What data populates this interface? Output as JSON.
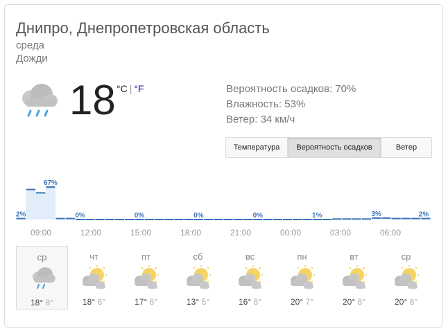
{
  "location": "Днипро, Днепропетровская область",
  "day": "среда",
  "condition": "Дожди",
  "current": {
    "temp": "18",
    "unit_c": "°C",
    "unit_sep": "|",
    "unit_f": "°F",
    "icon": "rain-cloud-icon"
  },
  "details": {
    "precip": "Вероятность осадков: 70%",
    "humidity": "Влажность: 53%",
    "wind": "Ветер: 34 км/ч"
  },
  "tabs": [
    {
      "label": "Температура",
      "active": false
    },
    {
      "label": "Вероятность осадков",
      "active": true
    },
    {
      "label": "Ветер",
      "active": false
    }
  ],
  "chart_data": {
    "type": "bar",
    "series_name": "Вероятность осадков",
    "unit": "%",
    "hourly_values": [
      2,
      62,
      55,
      67,
      2,
      2,
      0,
      0,
      0,
      0,
      0,
      0,
      0,
      0,
      0,
      0,
      0,
      0,
      0,
      0,
      0,
      0,
      0,
      0,
      0,
      0,
      0,
      0,
      0,
      0,
      0,
      0,
      1,
      1,
      1,
      1,
      3,
      3,
      2,
      2,
      2,
      2
    ],
    "labeled_points": [
      {
        "index": 0,
        "label": "2%"
      },
      {
        "index": 3,
        "label": "67%"
      },
      {
        "index": 6,
        "label": "0%"
      },
      {
        "index": 12,
        "label": "0%"
      },
      {
        "index": 18,
        "label": "0%"
      },
      {
        "index": 24,
        "label": "0%"
      },
      {
        "index": 30,
        "label": "1%"
      },
      {
        "index": 36,
        "label": "3%"
      },
      {
        "index": 41,
        "label": "2%"
      }
    ],
    "x_ticks": [
      "09:00",
      "12:00",
      "15:00",
      "18:00",
      "21:00",
      "00:00",
      "03:00",
      "06:00"
    ],
    "ylim": [
      0,
      100
    ],
    "color": "#3a72b7",
    "fill_color": "#e1edf9"
  },
  "forecast": [
    {
      "day": "ср",
      "hi": "18",
      "lo": "8",
      "icon": "rain-cloud-icon",
      "selected": true
    },
    {
      "day": "чт",
      "hi": "18",
      "lo": "6",
      "icon": "partly-cloudy-icon",
      "selected": false
    },
    {
      "day": "пт",
      "hi": "17",
      "lo": "6",
      "icon": "partly-cloudy-icon",
      "selected": false
    },
    {
      "day": "сб",
      "hi": "13",
      "lo": "5",
      "icon": "partly-cloudy-icon",
      "selected": false
    },
    {
      "day": "вс",
      "hi": "16",
      "lo": "8",
      "icon": "partly-cloudy-icon",
      "selected": false
    },
    {
      "day": "пн",
      "hi": "20",
      "lo": "7",
      "icon": "partly-cloudy-icon",
      "selected": false
    },
    {
      "day": "вт",
      "hi": "20",
      "lo": "8",
      "icon": "partly-cloudy-icon",
      "selected": false
    },
    {
      "day": "ср",
      "hi": "20",
      "lo": "8",
      "icon": "partly-cloudy-icon",
      "selected": false
    }
  ],
  "degree_symbol": "°",
  "colors": {
    "accent": "#3a72b7",
    "sun": "#f6d365",
    "cloud": "#bcbcbc",
    "rain": "#4aa3df"
  }
}
